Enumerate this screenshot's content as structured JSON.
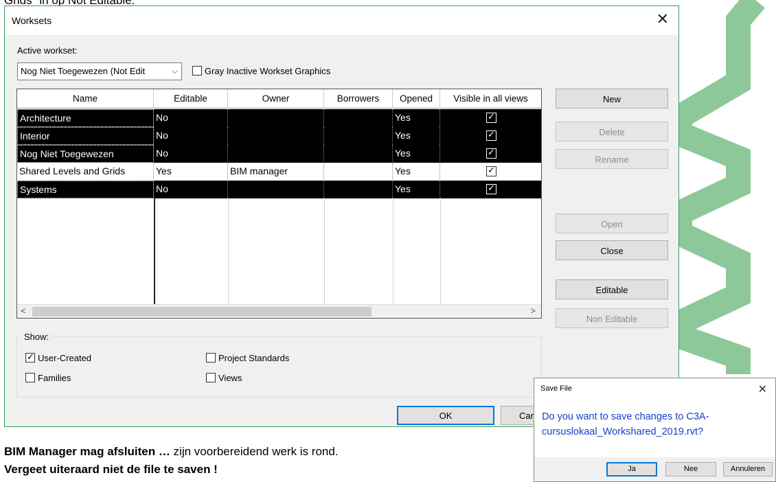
{
  "top_fragment": "Grids\" in op Not Editable.",
  "dialog": {
    "title": "Worksets",
    "active_workset_label": "Active workset:",
    "active_workset_value": "Nog Niet Toegewezen (Not Edit",
    "gray_inactive_label": "Gray Inactive Workset Graphics",
    "columns": [
      "Name",
      "Editable",
      "Owner",
      "Borrowers",
      "Opened",
      "Visible in all views"
    ],
    "rows": [
      {
        "name": "Architecture",
        "editable": "No",
        "owner": "",
        "borrowers": "",
        "opened": "Yes",
        "visible": true,
        "selected": true
      },
      {
        "name": "Interior",
        "editable": "No",
        "owner": "",
        "borrowers": "",
        "opened": "Yes",
        "visible": true,
        "selected": true
      },
      {
        "name": "Nog Niet Toegewezen",
        "editable": "No",
        "owner": "",
        "borrowers": "",
        "opened": "Yes",
        "visible": true,
        "selected": true
      },
      {
        "name": "Shared Levels and Grids",
        "editable": "Yes",
        "owner": "BIM manager",
        "borrowers": "",
        "opened": "Yes",
        "visible": true,
        "selected": false
      },
      {
        "name": "Systems",
        "editable": "No",
        "owner": "",
        "borrowers": "",
        "opened": "Yes",
        "visible": true,
        "selected": true
      }
    ],
    "buttons": {
      "new": "New",
      "delete": "Delete",
      "rename": "Rename",
      "open": "Open",
      "close": "Close",
      "editable": "Editable",
      "non_editable": "Non Editable"
    },
    "show": {
      "label": "Show:",
      "user_created": "User-Created",
      "families": "Families",
      "project_standards": "Project Standards",
      "views": "Views"
    },
    "ok": "OK",
    "cancel": "Can"
  },
  "save_dialog": {
    "title": "Save File",
    "message": "Do you want to save changes to C3A-cursuslokaal_Workshared_2019.rvt?",
    "yes": "Ja",
    "no": "Nee",
    "cancel": "Annuleren"
  },
  "caption": {
    "bold1": "BIM Manager mag afsluiten …",
    "normal": " zijn voorbereidend werk is rond.",
    "bold2": "Vergeet uiteraard niet de file te saven !"
  },
  "colors": {
    "accent_green": "#8dc89a",
    "border_green": "#38a05a",
    "link_blue": "#1a3ec8"
  }
}
